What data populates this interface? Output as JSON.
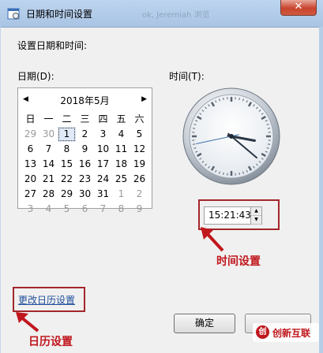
{
  "window": {
    "title": "日期和时间设置",
    "title_ghost": "ok, Jeremiah 浏览",
    "close_glyph": "✕"
  },
  "heading": "设置日期和时间:",
  "date_label": "日期(D):",
  "time_label": "时间(T):",
  "calendar": {
    "prev_glyph": "◀",
    "next_glyph": "▶",
    "month": "2018年5月",
    "weekdays": [
      "日",
      "一",
      "二",
      "三",
      "四",
      "五",
      "六"
    ],
    "weeks": [
      [
        {
          "d": "29",
          "o": true
        },
        {
          "d": "30",
          "o": true
        },
        {
          "d": "1",
          "t": true
        },
        {
          "d": "2"
        },
        {
          "d": "3"
        },
        {
          "d": "4"
        },
        {
          "d": "5"
        }
      ],
      [
        {
          "d": "6"
        },
        {
          "d": "7"
        },
        {
          "d": "8"
        },
        {
          "d": "9"
        },
        {
          "d": "10"
        },
        {
          "d": "11"
        },
        {
          "d": "12"
        }
      ],
      [
        {
          "d": "13"
        },
        {
          "d": "14"
        },
        {
          "d": "15"
        },
        {
          "d": "16"
        },
        {
          "d": "17"
        },
        {
          "d": "18"
        },
        {
          "d": "19"
        }
      ],
      [
        {
          "d": "20"
        },
        {
          "d": "21"
        },
        {
          "d": "22"
        },
        {
          "d": "23"
        },
        {
          "d": "24"
        },
        {
          "d": "25"
        },
        {
          "d": "26"
        }
      ],
      [
        {
          "d": "27"
        },
        {
          "d": "28"
        },
        {
          "d": "29"
        },
        {
          "d": "30"
        },
        {
          "d": "31"
        },
        {
          "d": "1",
          "o": true
        },
        {
          "d": "2",
          "o": true
        }
      ],
      [
        {
          "d": "3",
          "o": true
        },
        {
          "d": "4",
          "o": true
        },
        {
          "d": "5",
          "o": true
        },
        {
          "d": "6",
          "o": true
        },
        {
          "d": "7",
          "o": true
        },
        {
          "d": "8",
          "o": true
        },
        {
          "d": "9",
          "o": true
        }
      ]
    ]
  },
  "clock": {
    "hour": 15,
    "minute": 21,
    "second": 43
  },
  "time_value": "15:21:43",
  "spin_up": "▲",
  "spin_down": "▼",
  "annotations": {
    "time": "时间设置",
    "calendar": "日历设置"
  },
  "calendar_link": "更改日历设置",
  "ok_label": "确定",
  "watermark": {
    "icon": "创",
    "text": "创新互联"
  },
  "colors": {
    "annotation": "#c0171d",
    "link": "#1f4e9a"
  }
}
